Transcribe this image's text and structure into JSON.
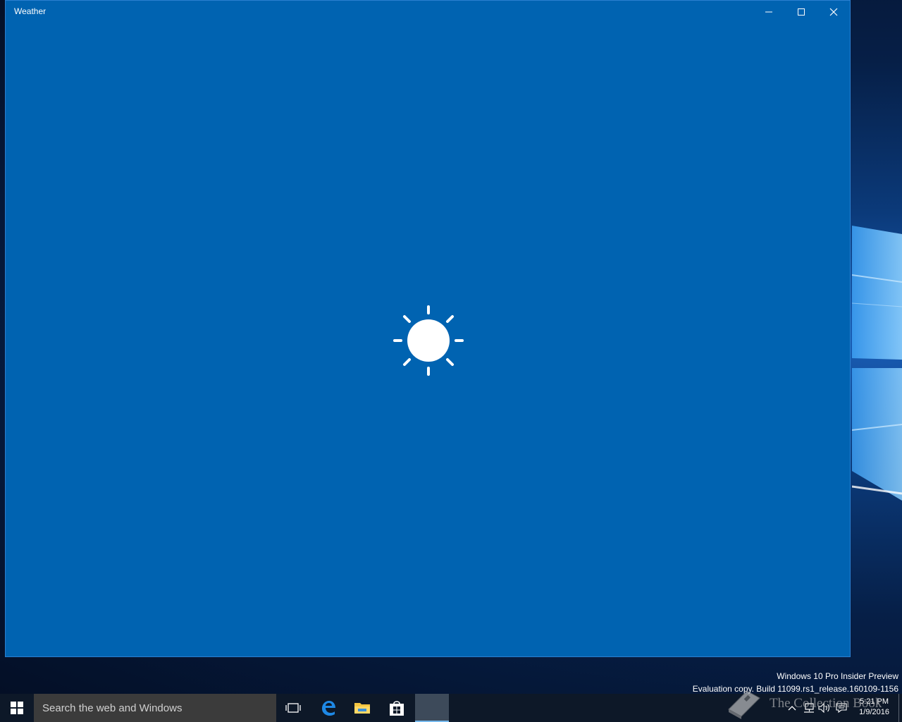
{
  "window": {
    "title": "Weather",
    "background_color": "#0063b1"
  },
  "splash": {
    "icon": "sun-icon"
  },
  "taskbar": {
    "search_placeholder": "Search the web and Windows",
    "apps": [
      {
        "name": "task-view",
        "icon": "task-view-icon"
      },
      {
        "name": "edge",
        "icon": "edge-icon"
      },
      {
        "name": "file-explorer",
        "icon": "folder-icon"
      },
      {
        "name": "store",
        "icon": "store-icon"
      },
      {
        "name": "weather",
        "icon": "weather-app-icon"
      }
    ],
    "clock": {
      "time": "5:21 PM",
      "date": "1/9/2016"
    }
  },
  "watermark": {
    "line1": "Windows 10 Pro Insider Preview",
    "line2": "Evaluation copy. Build 11099.rs1_release.160109-1156"
  },
  "overlay": {
    "text": "The Collection Book"
  }
}
